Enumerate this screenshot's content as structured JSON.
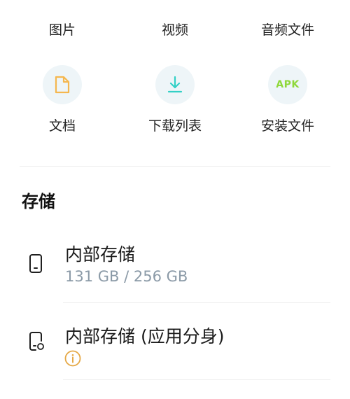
{
  "categories_top": [
    {
      "label": "图片"
    },
    {
      "label": "视频"
    },
    {
      "label": "音频文件"
    }
  ],
  "categories": [
    {
      "label": "文档",
      "icon": "document-icon",
      "color": "#f5b74f"
    },
    {
      "label": "下载列表",
      "icon": "download-icon",
      "color": "#33d0c6"
    },
    {
      "label": "安装文件",
      "icon": "apk-icon",
      "icon_text": "APK",
      "color": "#8fd83a"
    }
  ],
  "storage": {
    "title": "存储",
    "items": [
      {
        "title": "内部存储",
        "subtitle": "131 GB / 256 GB",
        "icon": "phone-icon"
      },
      {
        "title": "内部存储 (应用分身)",
        "icon": "phone-clone-icon",
        "info_icon": "info-icon",
        "info_color": "#e5a845"
      }
    ]
  }
}
